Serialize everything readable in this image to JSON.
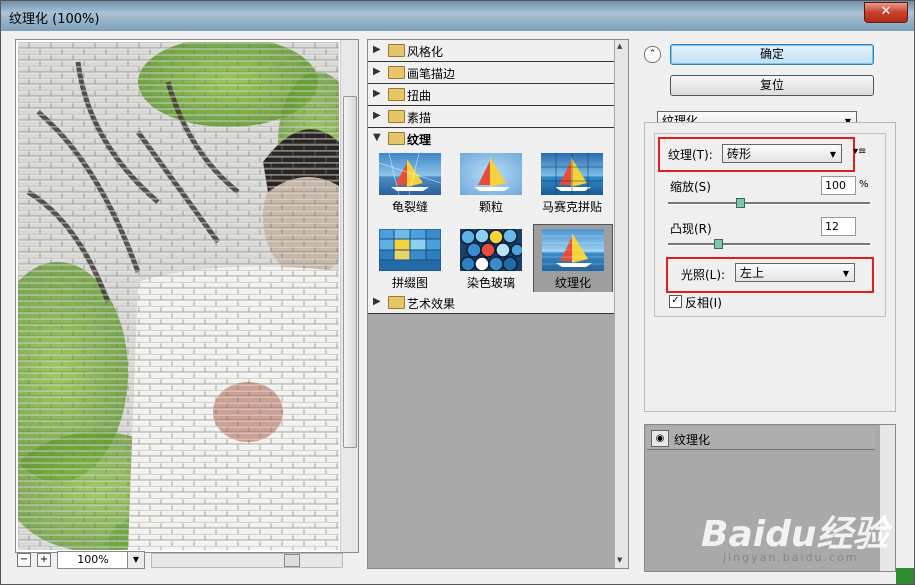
{
  "window": {
    "title": "纹理化 (100%)",
    "close_glyph": "✕"
  },
  "preview": {
    "zoom": "100%",
    "minus": "−",
    "plus": "+"
  },
  "filter_tree": {
    "categories_top": [
      {
        "label": "风格化",
        "expanded": false
      },
      {
        "label": "画笔描边",
        "expanded": false
      },
      {
        "label": "扭曲",
        "expanded": false
      },
      {
        "label": "素描",
        "expanded": false
      },
      {
        "label": "纹理",
        "expanded": true
      }
    ],
    "thumbnails": [
      {
        "label": "龟裂缝"
      },
      {
        "label": "颗粒"
      },
      {
        "label": "马赛克拼贴"
      },
      {
        "label": "拼缀图"
      },
      {
        "label": "染色玻璃"
      },
      {
        "label": "纹理化",
        "selected": true
      }
    ],
    "categories_bottom": [
      {
        "label": "艺术效果",
        "expanded": false
      }
    ]
  },
  "buttons": {
    "ok": "确定",
    "reset": "复位"
  },
  "settings": {
    "filter_select": "纹理化",
    "texture_label": "纹理(T):",
    "texture_value": "砖形",
    "scale_label": "缩放(S)",
    "scale_value": "100",
    "scale_unit": "%",
    "scale_fraction": 0.35,
    "relief_label": "凸现(R)",
    "relief_value": "12",
    "relief_fraction": 0.24,
    "light_label": "光照(L):",
    "light_value": "左上",
    "invert_label": "反相(I)",
    "invert_checked": true,
    "menu_glyph": "▾≡"
  },
  "layers": {
    "row_label": "纹理化"
  },
  "watermark": {
    "text": "Baidu经验",
    "sub": "jingyan.baidu.com"
  },
  "colors": {
    "highlight_box": "#e02020",
    "accent": "#2e7fc7"
  }
}
